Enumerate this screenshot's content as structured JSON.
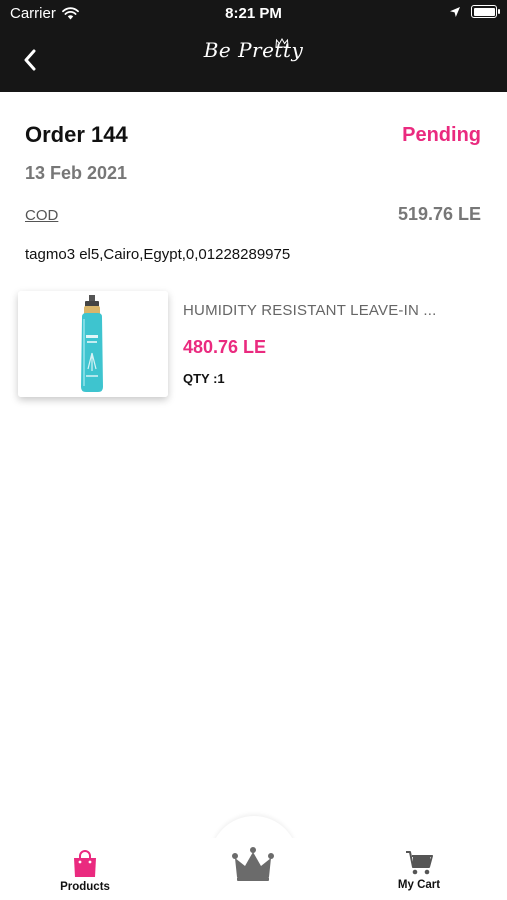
{
  "status_bar": {
    "carrier": "Carrier",
    "time": "8:21 PM"
  },
  "header": {
    "logo_text": "Be Pretty"
  },
  "order": {
    "title": "Order 144",
    "status": "Pending",
    "date": "13 Feb 2021",
    "payment_method": "COD",
    "total": "519.76 LE",
    "address": "tagmo3 el5,Cairo,Egypt,0,01228289975"
  },
  "items": [
    {
      "name": "HUMIDITY RESISTANT LEAVE-IN ...",
      "price": "480.76 LE",
      "qty": "QTY :1"
    }
  ],
  "tabbar": {
    "products_label": "Products",
    "cart_label": "My Cart"
  },
  "colors": {
    "accent": "#ea2a7f",
    "header_bg": "#161616",
    "muted_text": "#777777"
  },
  "icons": {
    "back": "chevron-left-icon",
    "products": "shopping-bag-icon",
    "home": "crown-icon",
    "cart": "cart-icon"
  }
}
